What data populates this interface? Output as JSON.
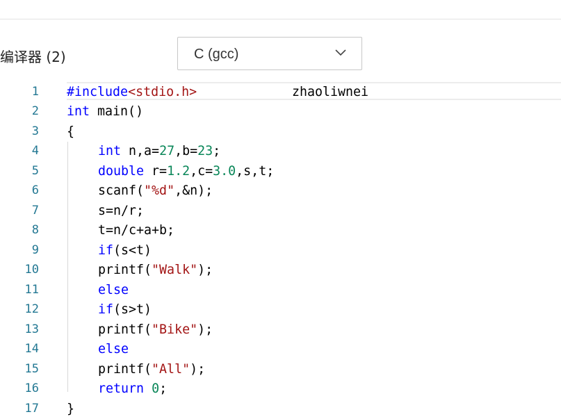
{
  "compiler": {
    "label": "编译器 (2)",
    "selected": "C (gcc)"
  },
  "editor": {
    "note": "zhaoliwnei",
    "lines": [
      {
        "num": "1"
      },
      {
        "num": "2"
      },
      {
        "num": "3"
      },
      {
        "num": "4"
      },
      {
        "num": "5"
      },
      {
        "num": "6"
      },
      {
        "num": "7"
      },
      {
        "num": "8"
      },
      {
        "num": "9"
      },
      {
        "num": "10"
      },
      {
        "num": "11"
      },
      {
        "num": "12"
      },
      {
        "num": "13"
      },
      {
        "num": "14"
      },
      {
        "num": "15"
      },
      {
        "num": "16"
      },
      {
        "num": "17"
      }
    ],
    "tokens": {
      "l1_kw": "#include",
      "l1_path": "<stdio.h>",
      "l2_kw": "int",
      "l2_rest": " main()",
      "l3": "{",
      "l4_kw": "int",
      "l4_a": " n,a=",
      "l4_n1": "27",
      "l4_b": ",b=",
      "l4_n2": "23",
      "l4_end": ";",
      "l5_kw": "double",
      "l5_a": " r=",
      "l5_n1": "1.2",
      "l5_b": ",c=",
      "l5_n2": "3.0",
      "l5_end": ",s,t;",
      "l6_a": "scanf(",
      "l6_s": "\"%d\"",
      "l6_end": ",&n);",
      "l7": "s=n/r;",
      "l8": "t=n/c+a+b;",
      "l9_kw": "if",
      "l9_rest": "(s<t)",
      "l10_a": "printf(",
      "l10_s": "\"Walk\"",
      "l10_end": ");",
      "l11_kw": "else",
      "l12_kw": "if",
      "l12_rest": "(s>t)",
      "l13_a": "printf(",
      "l13_s": "\"Bike\"",
      "l13_end": ");",
      "l14_kw": "else",
      "l15_a": "printf(",
      "l15_s": "\"All\"",
      "l15_end": ");",
      "l16_kw": "return",
      "l16_n": "0",
      "l16_end": ";",
      "l17": "}"
    }
  },
  "colors": {
    "keyword": "#0000ff",
    "number": "#098658",
    "string": "#a31515",
    "line_number": "#237893"
  }
}
